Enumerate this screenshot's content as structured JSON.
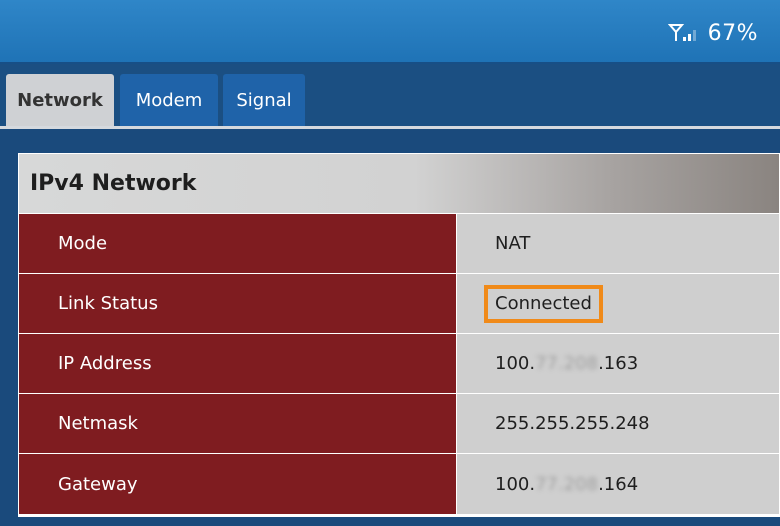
{
  "status": {
    "signal_icon": "signal-antenna-icon",
    "battery_percent": "67%"
  },
  "tabs": [
    {
      "label": "Network",
      "active": true
    },
    {
      "label": "Modem",
      "active": false
    },
    {
      "label": "Signal",
      "active": false
    }
  ],
  "panel": {
    "title": "IPv4 Network",
    "rows": [
      {
        "label": "Mode",
        "value": "NAT"
      },
      {
        "label": "Link Status",
        "value": "Connected",
        "highlight_color": "#f08a19"
      },
      {
        "label": "IP Address",
        "value_prefix": "100.",
        "value_masked": "77.208",
        "value_suffix": ".163"
      },
      {
        "label": "Netmask",
        "value": "255.255.255.248"
      },
      {
        "label": "Gateway",
        "value_prefix": "100.",
        "value_masked": "77.208",
        "value_suffix": ".164"
      }
    ]
  },
  "colors": {
    "topbar": "#2f86c8",
    "tab_active": "#cfd1d4",
    "tab_inactive": "#1f63a9",
    "label_cell": "#7f1c20",
    "value_cell": "#cfcfcf",
    "highlight": "#f08a19"
  }
}
